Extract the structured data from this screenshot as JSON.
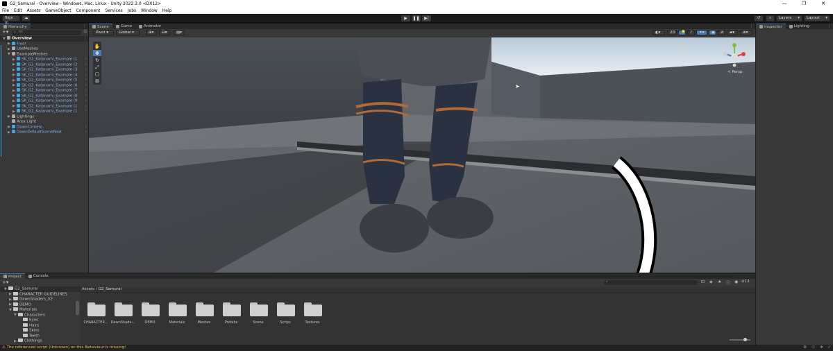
{
  "window": {
    "title": "G2_Samurai - Overview - Windows, Mac, Linux - Unity 2022.3.0 <DX12>",
    "controls": [
      "—",
      "❐",
      "✕"
    ]
  },
  "menu": [
    "File",
    "Edit",
    "Assets",
    "GameObject",
    "Component",
    "Services",
    "Jobs",
    "Window",
    "Help"
  ],
  "toolbar": {
    "sign_in": "Sign in",
    "layers": "Layers",
    "layout": "Layout"
  },
  "hierarchy": {
    "tab": "Hierarchy",
    "search_placeholder": "All",
    "root": "Overview",
    "items": [
      {
        "label": "Floor",
        "depth": 1,
        "selected": true
      },
      {
        "label": "UseMeshes",
        "depth": 1,
        "selected": false
      },
      {
        "label": "ExampleMeshes",
        "depth": 1,
        "selected": false
      },
      {
        "label": "SK_G2_Katanami_Example (1",
        "depth": 2,
        "selected": true
      },
      {
        "label": "SK_G2_Katanami_Example (2",
        "depth": 2,
        "selected": true
      },
      {
        "label": "SK_G2_Katanami_Example (3",
        "depth": 2,
        "selected": true
      },
      {
        "label": "SK_G2_Katanami_Example (4",
        "depth": 2,
        "selected": true
      },
      {
        "label": "SK_G2_Katanami_Example (5",
        "depth": 2,
        "selected": true
      },
      {
        "label": "SK_G2_Katanami_Example (6",
        "depth": 2,
        "selected": true
      },
      {
        "label": "SK_G2_Katanami_Example (7",
        "depth": 2,
        "selected": true
      },
      {
        "label": "SK_G2_Katanami_Example (8",
        "depth": 2,
        "selected": true
      },
      {
        "label": "SK_G2_Katanami_Example (9",
        "depth": 2,
        "selected": true
      },
      {
        "label": "SK_G2_Katanami_Example (1",
        "depth": 2,
        "selected": true
      },
      {
        "label": "SK_G2_Katanami_Example (1",
        "depth": 2,
        "selected": true
      },
      {
        "label": "Lightings",
        "depth": 1,
        "selected": false
      },
      {
        "label": "Area Light",
        "depth": 1,
        "selected": false
      },
      {
        "label": "DawnCamera",
        "depth": 1,
        "selected": true
      },
      {
        "label": "DawnDefaultSceneRoot",
        "depth": 1,
        "selected": true
      }
    ]
  },
  "scene": {
    "tabs": [
      "Scene",
      "Game",
      "Animator"
    ],
    "pivot": "Pivot",
    "global": "Global",
    "mode_2d": "2D",
    "persp": "< Persp"
  },
  "inspector": {
    "tabs": [
      "Inspector",
      "Lighting"
    ]
  },
  "project": {
    "tabs": [
      "Project",
      "Console"
    ],
    "tree": [
      {
        "label": "G2_Samurai",
        "depth": 0
      },
      {
        "label": "CHARACTER GUIDELINES",
        "depth": 1
      },
      {
        "label": "DawnShaders_V2",
        "depth": 1
      },
      {
        "label": "DEMO",
        "depth": 1
      },
      {
        "label": "Materials",
        "depth": 1
      },
      {
        "label": "Characters",
        "depth": 2
      },
      {
        "label": "Eyes",
        "depth": 3
      },
      {
        "label": "Hairs",
        "depth": 3
      },
      {
        "label": "Skins",
        "depth": 3
      },
      {
        "label": "Teeth",
        "depth": 3
      },
      {
        "label": "Clothings",
        "depth": 2
      }
    ],
    "breadcrumb": [
      "Assets",
      "G2_Samurai"
    ],
    "folders": [
      "CHARACTER...",
      "DawnShade...",
      "DEMO",
      "Materials",
      "Meshes",
      "Prefabs",
      "Scene",
      "Scrips",
      "Textures"
    ],
    "count": "13"
  },
  "status": {
    "message": "The referenced script (Unknown) on this Behaviour is missing!"
  },
  "colors": {
    "accent": "#3a79bb",
    "selected_text": "#7fb3ec",
    "warning": "#e8c35a"
  }
}
